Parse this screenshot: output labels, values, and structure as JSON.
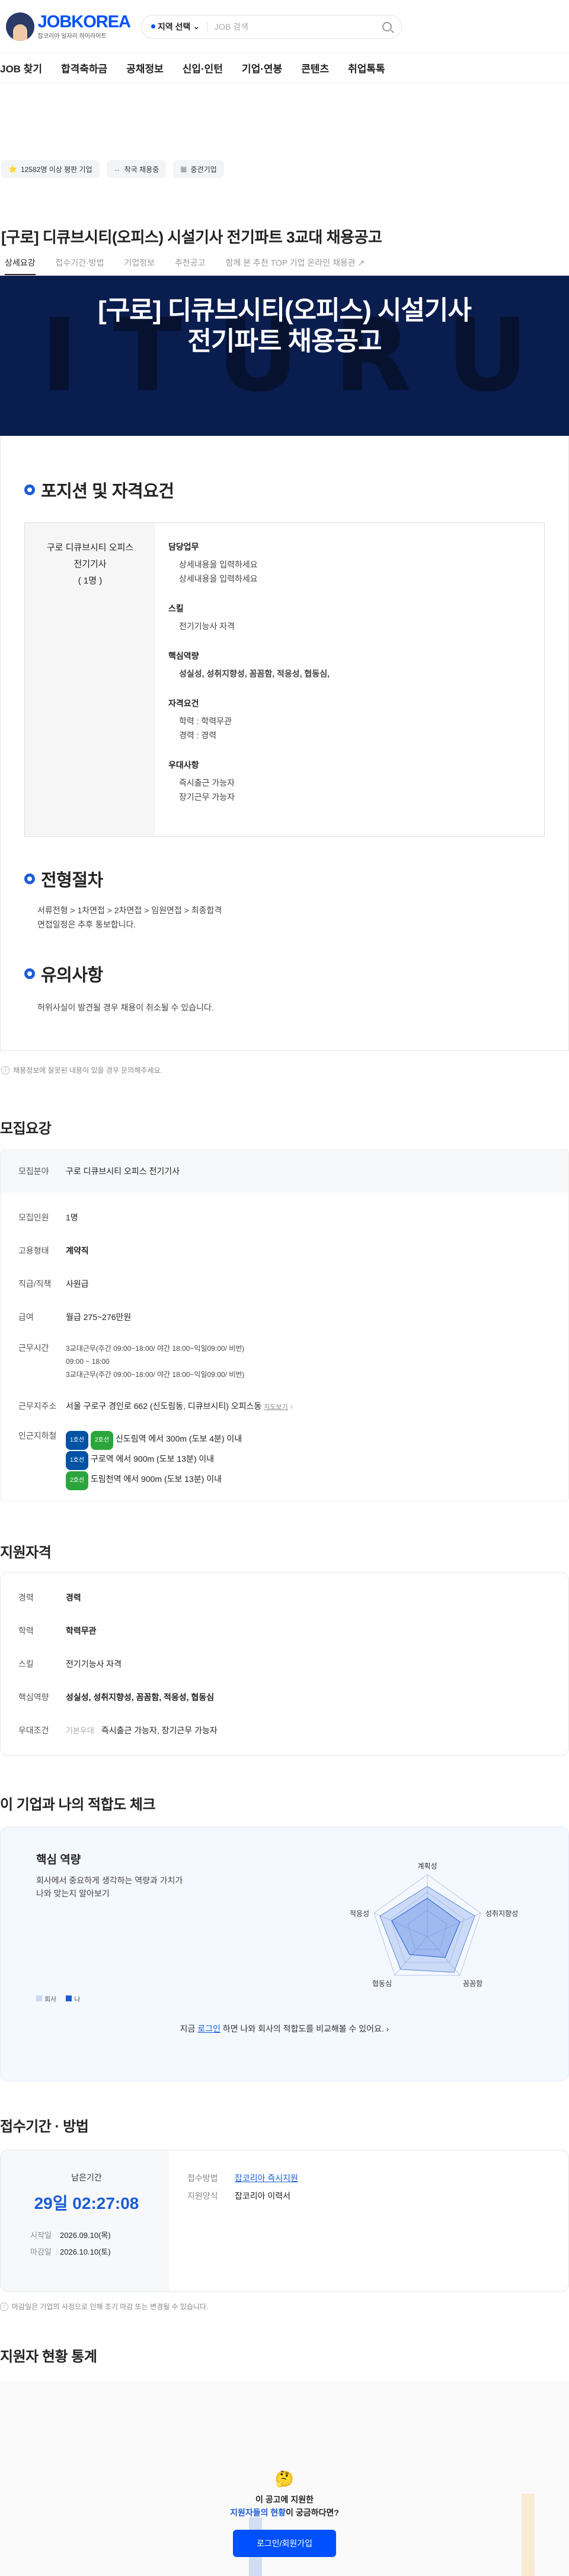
{
  "header": {
    "logo": "JOBKOREA",
    "tagline": "잡코리아 일자리 하이라이트",
    "region": "지역 선택",
    "search_placeholder": "JOB 검색"
  },
  "nav": [
    "JOB 찾기",
    "합격축하금",
    "공채정보",
    "신입·인턴",
    "기업·연봉",
    "콘텐츠",
    "취업톡톡"
  ],
  "badges": [
    {
      "icon": "⭐",
      "label": "12582명 이상 평판 기업"
    },
    {
      "icon": "↔",
      "label": "착국 채용중"
    },
    {
      "icon": "▦",
      "label": "중견기업"
    }
  ],
  "job": {
    "title": "[구로] 디큐브시티(오피스) 시설기사 전기파트 3교대 채용공고"
  },
  "tabs": [
    "상세요강",
    "접수기간·방법",
    "기업정보",
    "추천공고",
    "함께 본 추천 TOP 기업 온라인 채용관 ↗"
  ],
  "hero": {
    "line1": "[구로] 디큐브시티(오피스) 시설기사",
    "line2": "전기파트 채용공고",
    "bg": "I  T  U  R  U"
  },
  "position": {
    "heading": "포지션 및 자격요건",
    "left": [
      "구로 디큐브시티 오피스",
      "전기기사",
      "( 1명 )"
    ],
    "blocks": [
      {
        "t": "담당업무",
        "items": [
          "상세내용을 입력하세요",
          "상세내용을 입력하세요"
        ]
      },
      {
        "t": "스킬",
        "items": [
          "전기기능사 자격"
        ]
      },
      {
        "t": "핵심역량",
        "items": [
          "성실성, 성취지향성, 꼼꼼함, 적응성, 협동심,"
        ]
      },
      {
        "t": "자격요건",
        "items": [
          "학력 : 학력무관",
          "경력 : 경력"
        ]
      },
      {
        "t": "우대사항",
        "items": [
          "즉시출근 가능자",
          "장기근무 가능자"
        ]
      }
    ]
  },
  "process": {
    "heading": "전형절차",
    "items": [
      "서류전형 > 1차면접 > 2차면접 > 임원면접 > 최종합격",
      "면접일정은 추후 통보합니다."
    ]
  },
  "caution": {
    "heading": "유의사항",
    "items": [
      "허위사실이 발견될 경우 채용이 취소될 수 있습니다."
    ]
  },
  "report_notice": "채용정보에 잘못된 내용이 있을 경우 문의해주세요.",
  "recruit": {
    "heading": "모집요강",
    "field_k": "모집분야",
    "field_v": "구로 디큐브시티 오피스 전기기사",
    "rows": [
      {
        "k": "모집인원",
        "v": "1명"
      },
      {
        "k": "고용형태",
        "v": "계약직"
      },
      {
        "k": "직급/직책",
        "v": "사원급"
      },
      {
        "k": "급여",
        "v": "월급 275~276만원"
      }
    ],
    "worktime_k": "근무시간",
    "worktime": [
      "3교대근무(주간 09:00~18:00/ 야간 18:00~익일09:00/ 비번)",
      "09:00 ~ 18:00",
      "3교대근무(주간 09:00~18:00/ 야간 18:00~익일09:00/ 비번)"
    ],
    "addr_k": "근무지주소",
    "addr_v": "서울 구로구 경인로 662 (신도림동, 디큐브시티) 오피스동",
    "addr_map": "지도보기",
    "station_k": "인근지하철",
    "stations": [
      {
        "lines": [
          "1호선",
          "2호선"
        ],
        "colors": [
          "#0052a4",
          "#2ca63c"
        ],
        "text": "신도림역 에서 300m (도보 4분) 이내"
      },
      {
        "lines": [
          "1호선"
        ],
        "colors": [
          "#0052a4"
        ],
        "text": "구로역 에서 900m (도보 13분) 이내"
      },
      {
        "lines": [
          "2호선"
        ],
        "colors": [
          "#2ca63c"
        ],
        "text": "도림천역 에서 900m (도보 13분) 이내"
      }
    ]
  },
  "qual": {
    "heading": "지원자격",
    "rows": [
      {
        "k": "경력",
        "v": "경력",
        "blue": true
      },
      {
        "k": "학력",
        "v": "학력무관",
        "blue": true
      },
      {
        "k": "스킬",
        "v": "전기기능사 자격",
        "blue": false
      },
      {
        "k": "핵심역량",
        "v": "성실성, 성취지향성, 꼼꼼함, 적응성, 협동심",
        "blue": false
      }
    ],
    "pref_k": "우대조건",
    "pref_tag": "기본우대",
    "pref_v": "즉시출근 가능자, 장기근무 가능자"
  },
  "fit": {
    "heading": "이 기업과 나의 적합도 체크",
    "sub": "핵심 역량",
    "desc1": "회사에서 중요하게 생각하는 역량과 가치가",
    "desc2": "나와 맞는지 알아보기",
    "legend_company": "회사",
    "legend_me": "나",
    "axes": [
      "계획성",
      "성취지향성",
      "꼼꼼함",
      "협동심",
      "적응성"
    ],
    "login_pre": "지금 ",
    "login_link": "로그인",
    "login_post": " 하면 나와 회사의 적합도를 비교해볼 수 있어요. ›"
  },
  "period": {
    "heading": "접수기간 · 방법",
    "remain_label": "남은기간",
    "remain_days": "29일",
    "remain_time": "02:27:08",
    "start_k": "시작일",
    "start_v": "2026.09.10(목)",
    "end_k": "마감일",
    "end_v": "2026.10.10(토)",
    "method_k": "접수방법",
    "method_v": "잡코리아 즉시지원",
    "form_k": "지원양식",
    "form_v": "잡코리아 이력서",
    "notice": "마감일은 기업의 사정으로 인해 조기 마감 또는 변경될 수 있습니다."
  },
  "stats": {
    "heading": "지원자 현황 통계",
    "emoji": "🤔",
    "q1": "이 공고에 지원한",
    "q2_blue": "지원자들의 현황",
    "q2_post": "이 궁금하다면?",
    "button": "로그인/회원가입"
  },
  "colors": {
    "brand": "#0050ff",
    "navy": "#0a1d4f",
    "accent": "#1a5cd6"
  }
}
